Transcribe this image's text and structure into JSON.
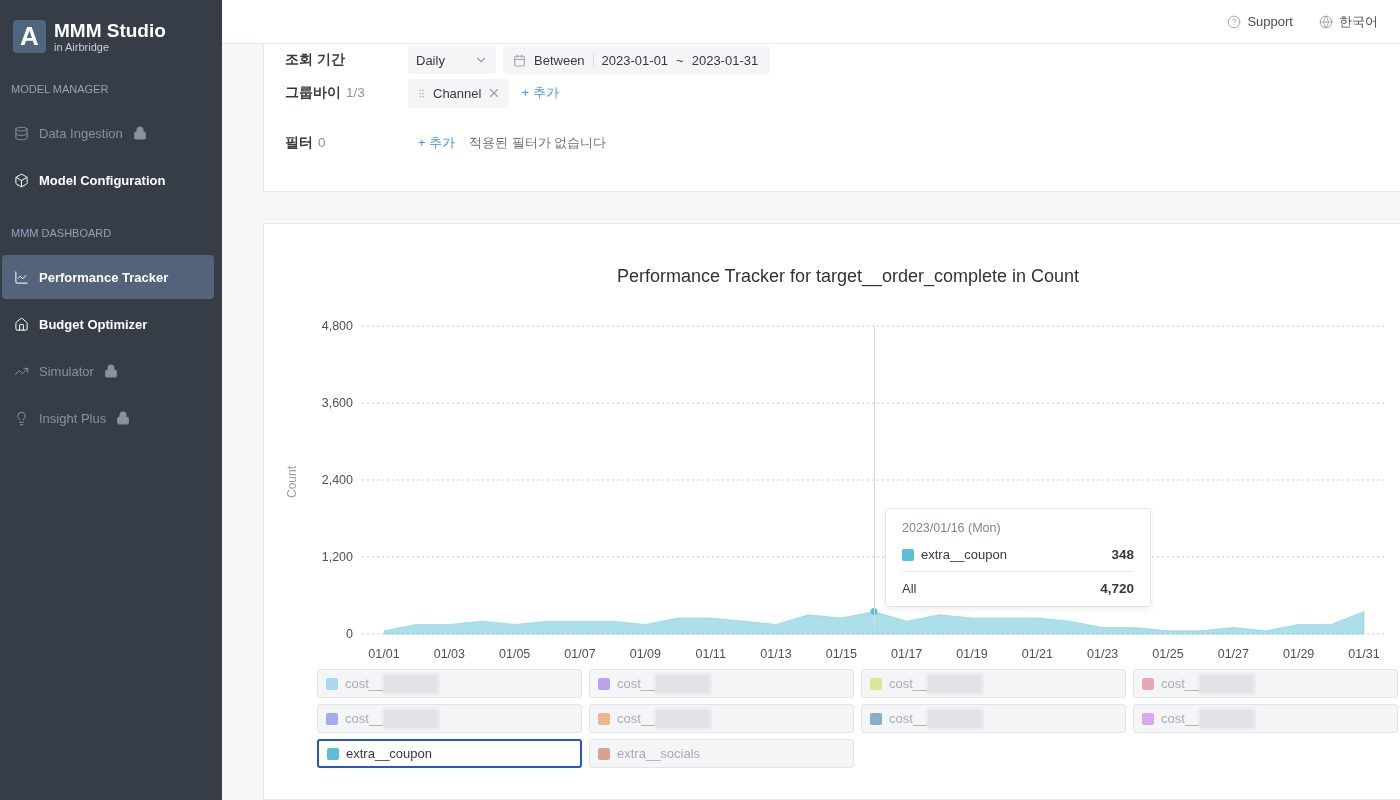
{
  "brand": {
    "letter": "A",
    "name": "MMM Studio",
    "sub": "in Airbridge"
  },
  "sidebar": {
    "sections": [
      {
        "title": "MODEL MANAGER",
        "items": [
          {
            "label": "Data Ingestion",
            "locked": true,
            "selected": false
          },
          {
            "label": "Model Configuration",
            "locked": false,
            "selected": false
          }
        ]
      },
      {
        "title": "MMM DASHBOARD",
        "items": [
          {
            "label": "Performance Tracker",
            "locked": false,
            "selected": true
          },
          {
            "label": "Budget Optimizer",
            "locked": false,
            "selected": false
          },
          {
            "label": "Simulator",
            "locked": true,
            "selected": false
          },
          {
            "label": "Insight Plus",
            "locked": true,
            "selected": false
          }
        ]
      }
    ]
  },
  "topbar": {
    "links": [
      "Support",
      "한국어"
    ]
  },
  "query": {
    "period": {
      "label": "조회 기간",
      "granularity": "Daily",
      "mode": "Between",
      "start": "2023-01-01",
      "separator": "~",
      "end": "2023-01-31"
    },
    "groupby": {
      "label": "그룹바이",
      "count": "1/3",
      "chips": [
        "Channel"
      ],
      "add": "+ 추가"
    },
    "filter": {
      "label": "필터",
      "count": "0",
      "add": "+ 추가",
      "empty": "적용된 필터가 없습니다"
    }
  },
  "chart": {
    "chart_data": {
      "type": "area",
      "title": "Performance Tracker for target__order_complete in Count",
      "ylabel": "Count",
      "categories": [
        "01/01",
        null,
        "01/03",
        null,
        "01/05",
        null,
        "01/07",
        null,
        "01/09",
        null,
        "01/11",
        null,
        "01/13",
        null,
        "01/15",
        null,
        "01/17",
        null,
        "01/19",
        null,
        "01/21",
        null,
        "01/23",
        null,
        "01/25",
        null,
        "01/27",
        null,
        "01/29",
        null,
        "01/31"
      ],
      "series": [
        {
          "name": "extra__coupon",
          "color": "#5bc0d6",
          "values": [
            50,
            150,
            150,
            200,
            150,
            200,
            200,
            200,
            150,
            250,
            250,
            200,
            150,
            300,
            250,
            350,
            200,
            300,
            250,
            250,
            250,
            200,
            100,
            100,
            50,
            50,
            100,
            50,
            150,
            150,
            350
          ]
        }
      ],
      "ylim": [
        0,
        4800
      ],
      "yticks": [
        {
          "value": 0,
          "label": "0"
        },
        {
          "value": 1200,
          "label": "1,200"
        },
        {
          "value": 2400,
          "label": "2,400"
        },
        {
          "value": 3600,
          "label": "3,600"
        },
        {
          "value": 4800,
          "label": "4,800"
        }
      ],
      "grid": true
    },
    "tooltip": {
      "date": "2023/01/16 (Mon)",
      "values": [
        "348"
      ],
      "total_label": "All",
      "total": "4,720"
    },
    "legend": [
      {
        "label": "cost__",
        "kind": "redacted",
        "color": "#a9d8f5",
        "selected": false
      },
      {
        "label": "cost__",
        "kind": "redacted",
        "color": "#b9a3ef",
        "selected": false
      },
      {
        "label": "cost__",
        "kind": "redacted",
        "color": "#d9e69a",
        "selected": false
      },
      {
        "label": "cost__",
        "kind": "redacted",
        "color": "#e7a6b3",
        "selected": false
      },
      {
        "label": "cost__",
        "kind": "redacted",
        "color": "#a3aaee",
        "selected": false
      },
      {
        "label": "cost__",
        "kind": "redacted",
        "color": "#eab88e",
        "selected": false
      },
      {
        "label": "cost__",
        "kind": "redacted",
        "color": "#86afc9",
        "selected": false
      },
      {
        "label": "cost__",
        "kind": "redacted",
        "color": "#dca6ee",
        "selected": false
      },
      {
        "label": "extra__coupon",
        "kind": "plain",
        "color": "#5bc0d6",
        "selected": true
      },
      {
        "label": "extra__socials",
        "kind": "plain",
        "color": "#d6a48e",
        "selected": false
      }
    ]
  }
}
